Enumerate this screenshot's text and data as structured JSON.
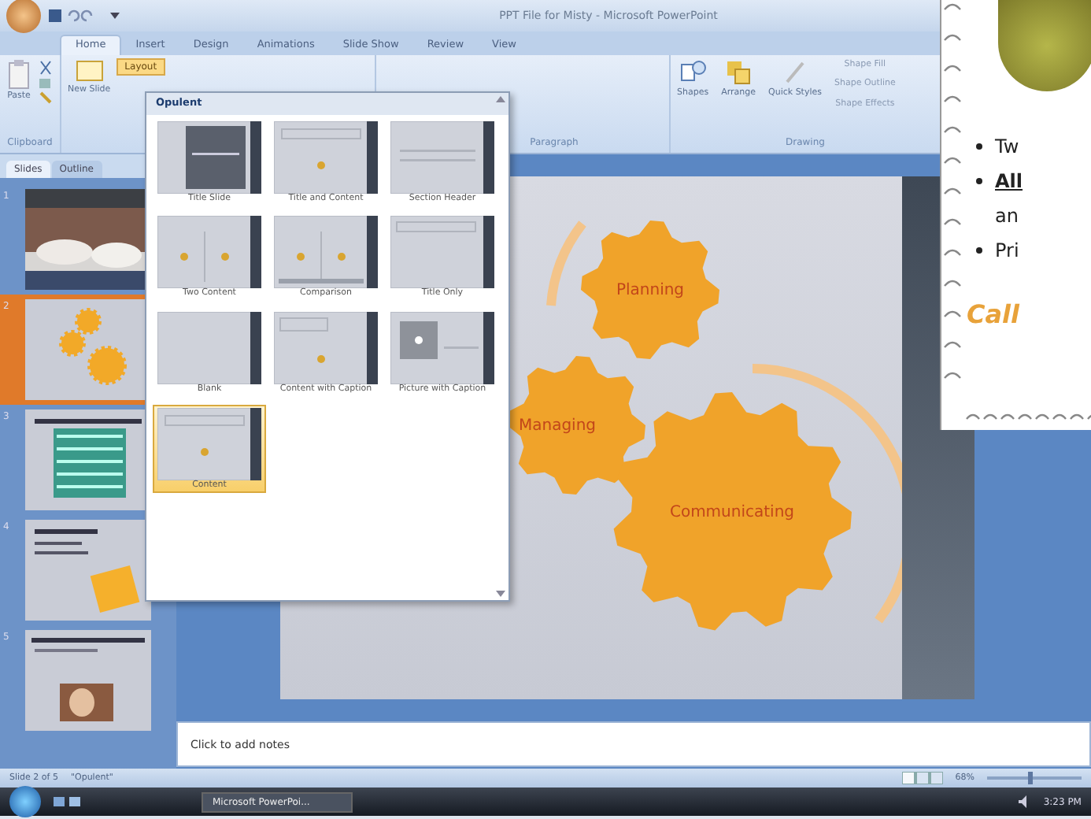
{
  "window": {
    "title": "PPT File for Misty - Microsoft PowerPoint"
  },
  "ribbon_tabs": [
    {
      "label": "Home",
      "selected": true
    },
    {
      "label": "Insert",
      "selected": false
    },
    {
      "label": "Design",
      "selected": false
    },
    {
      "label": "Animations",
      "selected": false
    },
    {
      "label": "Slide Show",
      "selected": false
    },
    {
      "label": "Review",
      "selected": false
    },
    {
      "label": "View",
      "selected": false
    }
  ],
  "ribbon": {
    "clipboard": {
      "label": "Clipboard",
      "paste": "Paste"
    },
    "new_slide": "New Slide",
    "layout_button": {
      "label": "Layout",
      "expanded": true
    },
    "paragraph_label": "Paragraph",
    "drawing": {
      "label": "Drawing",
      "buttons": [
        "Shapes",
        "Arrange",
        "Quick Styles"
      ],
      "options": [
        "Shape Fill",
        "Shape Outline",
        "Shape Effects"
      ]
    }
  },
  "layout_gallery": {
    "header": "Opulent",
    "items": [
      {
        "label": "Title Slide",
        "kind": "title",
        "selected": false
      },
      {
        "label": "Title and Content",
        "kind": "content",
        "selected": false
      },
      {
        "label": "Section Header",
        "kind": "header",
        "selected": false
      },
      {
        "label": "Two Content",
        "kind": "two",
        "selected": false
      },
      {
        "label": "Comparison",
        "kind": "comparison",
        "selected": false
      },
      {
        "label": "Title Only",
        "kind": "title-only",
        "selected": false
      },
      {
        "label": "Blank",
        "kind": "blank",
        "selected": false
      },
      {
        "label": "Content with Caption",
        "kind": "caption",
        "selected": false
      },
      {
        "label": "Picture with Caption",
        "kind": "picture",
        "selected": false
      },
      {
        "label": "Content",
        "kind": "content",
        "selected": true
      }
    ]
  },
  "slides_panel": {
    "tabs": [
      {
        "label": "Slides",
        "selected": true
      },
      {
        "label": "Outline",
        "selected": false
      }
    ],
    "thumbnails": [
      {
        "number": "1",
        "selected": false
      },
      {
        "number": "2",
        "kind": "gears",
        "selected": true
      },
      {
        "number": "3",
        "kind": "table",
        "selected": false
      },
      {
        "number": "4",
        "kind": "note",
        "selected": false
      },
      {
        "number": "5",
        "kind": "photo-text",
        "selected": false
      }
    ]
  },
  "slide": {
    "gears": [
      "Planning",
      "Managing",
      "Communicating"
    ]
  },
  "notes": {
    "placeholder": "Click to add notes"
  },
  "status_bar": {
    "slide": "Slide 2 of 5",
    "theme": "\"Opulent\"",
    "zoom": "68%",
    "zoom_slider": {
      "level": 0.45
    }
  },
  "taskbar": {
    "button": "Microsoft PowerPoi...",
    "clock": "3:23 PM"
  },
  "overlay": {
    "lines": [
      {
        "kind": "bullet",
        "text": "Tw",
        "underlined": false
      },
      {
        "kind": "bullet",
        "text": "All",
        "underlined": true
      },
      {
        "kind": "continuation",
        "text": "an",
        "underlined": false
      },
      {
        "kind": "bullet",
        "text": "Pri",
        "underlined": false
      },
      {
        "kind": "callout",
        "text": "Call",
        "underlined": false
      }
    ]
  }
}
